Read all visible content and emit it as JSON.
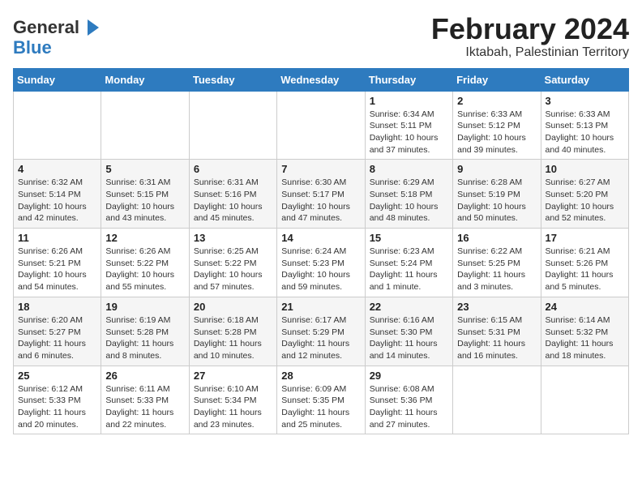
{
  "header": {
    "logo_general": "General",
    "logo_blue": "Blue",
    "title": "February 2024",
    "subtitle": "Iktabah, Palestinian Territory"
  },
  "calendar": {
    "days_of_week": [
      "Sunday",
      "Monday",
      "Tuesday",
      "Wednesday",
      "Thursday",
      "Friday",
      "Saturday"
    ],
    "weeks": [
      [
        {
          "day": "",
          "info": ""
        },
        {
          "day": "",
          "info": ""
        },
        {
          "day": "",
          "info": ""
        },
        {
          "day": "",
          "info": ""
        },
        {
          "day": "1",
          "info": "Sunrise: 6:34 AM\nSunset: 5:11 PM\nDaylight: 10 hours\nand 37 minutes."
        },
        {
          "day": "2",
          "info": "Sunrise: 6:33 AM\nSunset: 5:12 PM\nDaylight: 10 hours\nand 39 minutes."
        },
        {
          "day": "3",
          "info": "Sunrise: 6:33 AM\nSunset: 5:13 PM\nDaylight: 10 hours\nand 40 minutes."
        }
      ],
      [
        {
          "day": "4",
          "info": "Sunrise: 6:32 AM\nSunset: 5:14 PM\nDaylight: 10 hours\nand 42 minutes."
        },
        {
          "day": "5",
          "info": "Sunrise: 6:31 AM\nSunset: 5:15 PM\nDaylight: 10 hours\nand 43 minutes."
        },
        {
          "day": "6",
          "info": "Sunrise: 6:31 AM\nSunset: 5:16 PM\nDaylight: 10 hours\nand 45 minutes."
        },
        {
          "day": "7",
          "info": "Sunrise: 6:30 AM\nSunset: 5:17 PM\nDaylight: 10 hours\nand 47 minutes."
        },
        {
          "day": "8",
          "info": "Sunrise: 6:29 AM\nSunset: 5:18 PM\nDaylight: 10 hours\nand 48 minutes."
        },
        {
          "day": "9",
          "info": "Sunrise: 6:28 AM\nSunset: 5:19 PM\nDaylight: 10 hours\nand 50 minutes."
        },
        {
          "day": "10",
          "info": "Sunrise: 6:27 AM\nSunset: 5:20 PM\nDaylight: 10 hours\nand 52 minutes."
        }
      ],
      [
        {
          "day": "11",
          "info": "Sunrise: 6:26 AM\nSunset: 5:21 PM\nDaylight: 10 hours\nand 54 minutes."
        },
        {
          "day": "12",
          "info": "Sunrise: 6:26 AM\nSunset: 5:22 PM\nDaylight: 10 hours\nand 55 minutes."
        },
        {
          "day": "13",
          "info": "Sunrise: 6:25 AM\nSunset: 5:22 PM\nDaylight: 10 hours\nand 57 minutes."
        },
        {
          "day": "14",
          "info": "Sunrise: 6:24 AM\nSunset: 5:23 PM\nDaylight: 10 hours\nand 59 minutes."
        },
        {
          "day": "15",
          "info": "Sunrise: 6:23 AM\nSunset: 5:24 PM\nDaylight: 11 hours\nand 1 minute."
        },
        {
          "day": "16",
          "info": "Sunrise: 6:22 AM\nSunset: 5:25 PM\nDaylight: 11 hours\nand 3 minutes."
        },
        {
          "day": "17",
          "info": "Sunrise: 6:21 AM\nSunset: 5:26 PM\nDaylight: 11 hours\nand 5 minutes."
        }
      ],
      [
        {
          "day": "18",
          "info": "Sunrise: 6:20 AM\nSunset: 5:27 PM\nDaylight: 11 hours\nand 6 minutes."
        },
        {
          "day": "19",
          "info": "Sunrise: 6:19 AM\nSunset: 5:28 PM\nDaylight: 11 hours\nand 8 minutes."
        },
        {
          "day": "20",
          "info": "Sunrise: 6:18 AM\nSunset: 5:28 PM\nDaylight: 11 hours\nand 10 minutes."
        },
        {
          "day": "21",
          "info": "Sunrise: 6:17 AM\nSunset: 5:29 PM\nDaylight: 11 hours\nand 12 minutes."
        },
        {
          "day": "22",
          "info": "Sunrise: 6:16 AM\nSunset: 5:30 PM\nDaylight: 11 hours\nand 14 minutes."
        },
        {
          "day": "23",
          "info": "Sunrise: 6:15 AM\nSunset: 5:31 PM\nDaylight: 11 hours\nand 16 minutes."
        },
        {
          "day": "24",
          "info": "Sunrise: 6:14 AM\nSunset: 5:32 PM\nDaylight: 11 hours\nand 18 minutes."
        }
      ],
      [
        {
          "day": "25",
          "info": "Sunrise: 6:12 AM\nSunset: 5:33 PM\nDaylight: 11 hours\nand 20 minutes."
        },
        {
          "day": "26",
          "info": "Sunrise: 6:11 AM\nSunset: 5:33 PM\nDaylight: 11 hours\nand 22 minutes."
        },
        {
          "day": "27",
          "info": "Sunrise: 6:10 AM\nSunset: 5:34 PM\nDaylight: 11 hours\nand 23 minutes."
        },
        {
          "day": "28",
          "info": "Sunrise: 6:09 AM\nSunset: 5:35 PM\nDaylight: 11 hours\nand 25 minutes."
        },
        {
          "day": "29",
          "info": "Sunrise: 6:08 AM\nSunset: 5:36 PM\nDaylight: 11 hours\nand 27 minutes."
        },
        {
          "day": "",
          "info": ""
        },
        {
          "day": "",
          "info": ""
        }
      ]
    ]
  }
}
